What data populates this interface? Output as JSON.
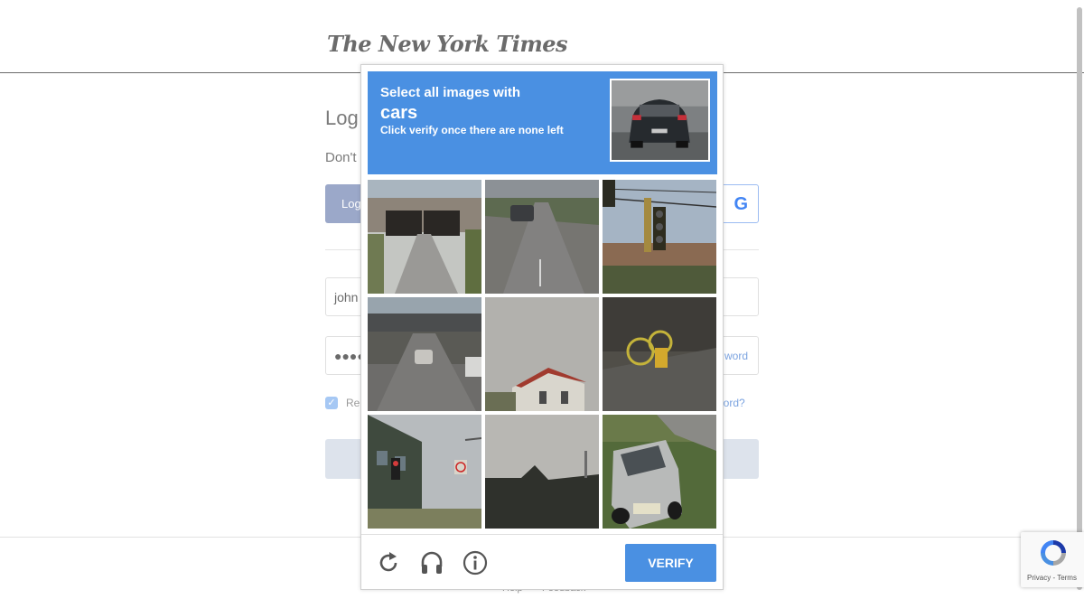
{
  "site": {
    "logo_text": "The New York Times"
  },
  "login": {
    "title": "Log",
    "signup_text": "Don't",
    "facebook_label": "Log",
    "email_value": "john",
    "password_mask": "●●●●●",
    "show_password_label": "word",
    "remember_label": "Re",
    "forgot_label": "ssword?"
  },
  "footer": {
    "help": "Help",
    "feedback": "Feedback"
  },
  "captcha": {
    "instruction": "Select all images with",
    "target": "cars",
    "subinstruction": "Click verify once there are none left",
    "verify_label": "VERIFY",
    "tiles": [
      {
        "name": "tile-underpass"
      },
      {
        "name": "tile-road-car"
      },
      {
        "name": "tile-traffic-light"
      },
      {
        "name": "tile-bridge-traffic"
      },
      {
        "name": "tile-house-roof"
      },
      {
        "name": "tile-bicycle"
      },
      {
        "name": "tile-building-signal"
      },
      {
        "name": "tile-dark-rooftop"
      },
      {
        "name": "tile-silver-suv"
      }
    ]
  },
  "badge": {
    "text": "Privacy - Terms"
  },
  "colors": {
    "accent": "#4a90e2",
    "header_bg": "#4a90e2"
  },
  "icons": [
    "reload-icon",
    "audio-icon",
    "info-icon",
    "google-icon",
    "recaptcha-logo-icon"
  ]
}
